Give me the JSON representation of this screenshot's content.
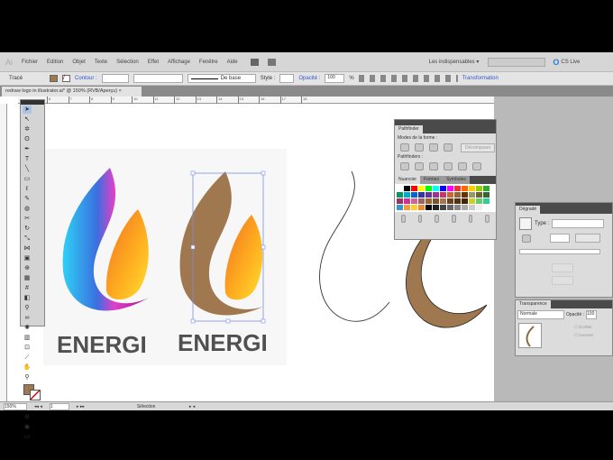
{
  "app_logo": "Ai",
  "menu": [
    "Fichier",
    "Edition",
    "Objet",
    "Texte",
    "Sélection",
    "Effet",
    "Affichage",
    "Fenêtre",
    "Aide"
  ],
  "workspace": "Les indispensables",
  "cs_live": "CS Live",
  "control": {
    "object_type": "Tracé",
    "stroke_label": "Contour :",
    "stroke_style": "De base",
    "style_label": "Style :",
    "opacity_label": "Opacité :",
    "opacity_value": "100",
    "percent": "%",
    "transform_link": "Transformation"
  },
  "doc_tab": "redraw logo in illustrator.ai* @ 150% (RVB/Aperçu)",
  "ruler_ticks": [
    "6",
    "7",
    "8",
    "9",
    "10",
    "11",
    "12",
    "13",
    "14",
    "15",
    "16",
    "17",
    "18"
  ],
  "artwork_text": "ENERGI",
  "pathfinder": {
    "tab": "Pathfinder",
    "shape_modes": "Modes de la forme :",
    "expand": "Décomposer",
    "pathfinders": "Pathfinders :"
  },
  "swatches": {
    "tabs": [
      "Nuancier",
      "Formes",
      "Symboles"
    ],
    "colors": [
      "#ffffff",
      "#000000",
      "#ff0000",
      "#ffff00",
      "#00ff00",
      "#00ffff",
      "#0000ff",
      "#ff00ff",
      "#ee3333",
      "#ff6600",
      "#ffcc00",
      "#99cc00",
      "#33aa33",
      "#009966",
      "#00aacc",
      "#0066cc",
      "#3333aa",
      "#663399",
      "#993399",
      "#cc3366",
      "#cc6633",
      "#996633",
      "#663300",
      "#999966",
      "#666633",
      "#336633",
      "#993366",
      "#cc3399",
      "#cc6699",
      "#996666",
      "#996633",
      "#775533",
      "#aa7744",
      "#664422",
      "#553311",
      "#442200",
      "#cccc33",
      "#66cc66",
      "#33cc99",
      "#3399cc",
      "#ff9933",
      "#ffcc33",
      "#ee8833",
      "#000000",
      "#222222",
      "#444444",
      "#666666",
      "#888888",
      "#aaaaaa",
      "#cccccc",
      "#eeeeee"
    ]
  },
  "gradient": {
    "tab": "Dégradé",
    "type_label": "Type :"
  },
  "transparency": {
    "tab": "Transparence",
    "mode": "Normale",
    "opacity_label": "Opacité :",
    "opacity_value": "100",
    "clip": "Écrêter",
    "invert": "Inverser"
  },
  "status": {
    "zoom": "150%",
    "page": "1",
    "tool": "Sélection"
  },
  "colors": {
    "fill": "#a0784f"
  }
}
